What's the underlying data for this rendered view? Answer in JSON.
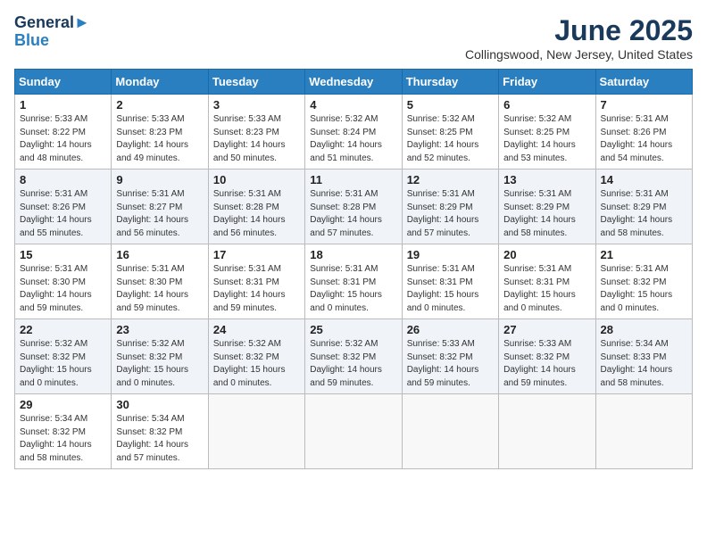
{
  "logo": {
    "line1": "General",
    "line2": "Blue"
  },
  "title": "June 2025",
  "location": "Collingswood, New Jersey, United States",
  "weekdays": [
    "Sunday",
    "Monday",
    "Tuesday",
    "Wednesday",
    "Thursday",
    "Friday",
    "Saturday"
  ],
  "weeks": [
    [
      {
        "day": "1",
        "info": "Sunrise: 5:33 AM\nSunset: 8:22 PM\nDaylight: 14 hours\nand 48 minutes."
      },
      {
        "day": "2",
        "info": "Sunrise: 5:33 AM\nSunset: 8:23 PM\nDaylight: 14 hours\nand 49 minutes."
      },
      {
        "day": "3",
        "info": "Sunrise: 5:33 AM\nSunset: 8:23 PM\nDaylight: 14 hours\nand 50 minutes."
      },
      {
        "day": "4",
        "info": "Sunrise: 5:32 AM\nSunset: 8:24 PM\nDaylight: 14 hours\nand 51 minutes."
      },
      {
        "day": "5",
        "info": "Sunrise: 5:32 AM\nSunset: 8:25 PM\nDaylight: 14 hours\nand 52 minutes."
      },
      {
        "day": "6",
        "info": "Sunrise: 5:32 AM\nSunset: 8:25 PM\nDaylight: 14 hours\nand 53 minutes."
      },
      {
        "day": "7",
        "info": "Sunrise: 5:31 AM\nSunset: 8:26 PM\nDaylight: 14 hours\nand 54 minutes."
      }
    ],
    [
      {
        "day": "8",
        "info": "Sunrise: 5:31 AM\nSunset: 8:26 PM\nDaylight: 14 hours\nand 55 minutes."
      },
      {
        "day": "9",
        "info": "Sunrise: 5:31 AM\nSunset: 8:27 PM\nDaylight: 14 hours\nand 56 minutes."
      },
      {
        "day": "10",
        "info": "Sunrise: 5:31 AM\nSunset: 8:28 PM\nDaylight: 14 hours\nand 56 minutes."
      },
      {
        "day": "11",
        "info": "Sunrise: 5:31 AM\nSunset: 8:28 PM\nDaylight: 14 hours\nand 57 minutes."
      },
      {
        "day": "12",
        "info": "Sunrise: 5:31 AM\nSunset: 8:29 PM\nDaylight: 14 hours\nand 57 minutes."
      },
      {
        "day": "13",
        "info": "Sunrise: 5:31 AM\nSunset: 8:29 PM\nDaylight: 14 hours\nand 58 minutes."
      },
      {
        "day": "14",
        "info": "Sunrise: 5:31 AM\nSunset: 8:29 PM\nDaylight: 14 hours\nand 58 minutes."
      }
    ],
    [
      {
        "day": "15",
        "info": "Sunrise: 5:31 AM\nSunset: 8:30 PM\nDaylight: 14 hours\nand 59 minutes."
      },
      {
        "day": "16",
        "info": "Sunrise: 5:31 AM\nSunset: 8:30 PM\nDaylight: 14 hours\nand 59 minutes."
      },
      {
        "day": "17",
        "info": "Sunrise: 5:31 AM\nSunset: 8:31 PM\nDaylight: 14 hours\nand 59 minutes."
      },
      {
        "day": "18",
        "info": "Sunrise: 5:31 AM\nSunset: 8:31 PM\nDaylight: 15 hours\nand 0 minutes."
      },
      {
        "day": "19",
        "info": "Sunrise: 5:31 AM\nSunset: 8:31 PM\nDaylight: 15 hours\nand 0 minutes."
      },
      {
        "day": "20",
        "info": "Sunrise: 5:31 AM\nSunset: 8:31 PM\nDaylight: 15 hours\nand 0 minutes."
      },
      {
        "day": "21",
        "info": "Sunrise: 5:31 AM\nSunset: 8:32 PM\nDaylight: 15 hours\nand 0 minutes."
      }
    ],
    [
      {
        "day": "22",
        "info": "Sunrise: 5:32 AM\nSunset: 8:32 PM\nDaylight: 15 hours\nand 0 minutes."
      },
      {
        "day": "23",
        "info": "Sunrise: 5:32 AM\nSunset: 8:32 PM\nDaylight: 15 hours\nand 0 minutes."
      },
      {
        "day": "24",
        "info": "Sunrise: 5:32 AM\nSunset: 8:32 PM\nDaylight: 15 hours\nand 0 minutes."
      },
      {
        "day": "25",
        "info": "Sunrise: 5:32 AM\nSunset: 8:32 PM\nDaylight: 14 hours\nand 59 minutes."
      },
      {
        "day": "26",
        "info": "Sunrise: 5:33 AM\nSunset: 8:32 PM\nDaylight: 14 hours\nand 59 minutes."
      },
      {
        "day": "27",
        "info": "Sunrise: 5:33 AM\nSunset: 8:32 PM\nDaylight: 14 hours\nand 59 minutes."
      },
      {
        "day": "28",
        "info": "Sunrise: 5:34 AM\nSunset: 8:33 PM\nDaylight: 14 hours\nand 58 minutes."
      }
    ],
    [
      {
        "day": "29",
        "info": "Sunrise: 5:34 AM\nSunset: 8:32 PM\nDaylight: 14 hours\nand 58 minutes."
      },
      {
        "day": "30",
        "info": "Sunrise: 5:34 AM\nSunset: 8:32 PM\nDaylight: 14 hours\nand 57 minutes."
      },
      {
        "day": "",
        "info": ""
      },
      {
        "day": "",
        "info": ""
      },
      {
        "day": "",
        "info": ""
      },
      {
        "day": "",
        "info": ""
      },
      {
        "day": "",
        "info": ""
      }
    ]
  ]
}
